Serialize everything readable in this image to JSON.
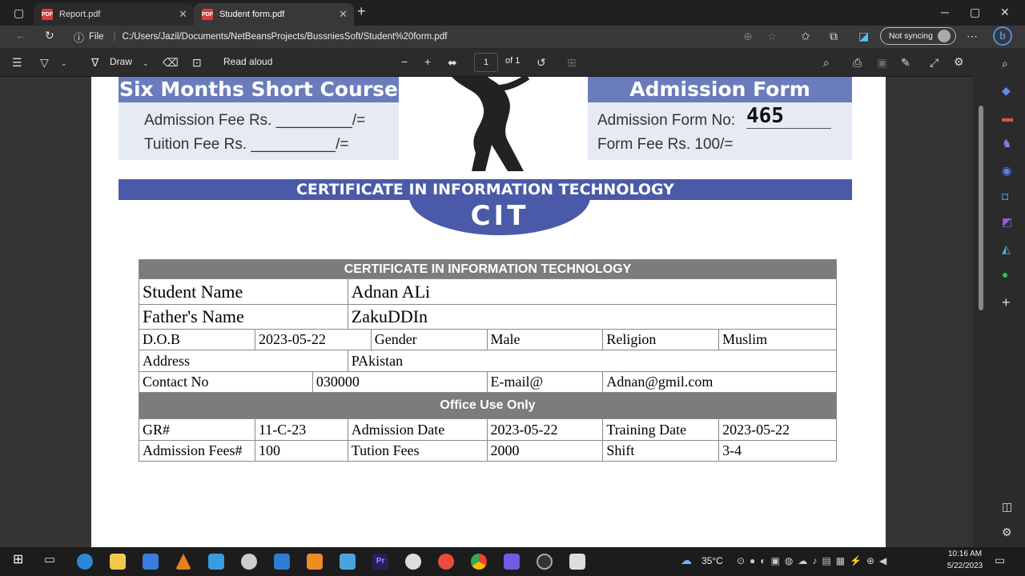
{
  "tabs": [
    {
      "label": "Report.pdf"
    },
    {
      "label": "Student form.pdf"
    }
  ],
  "address": {
    "prefix": "File",
    "url": "C:/Users/Jazil/Documents/NetBeansProjects/BussniesSoft/Student%20form.pdf",
    "sync_label": "Not syncing"
  },
  "pdf_toolbar": {
    "draw_label": "Draw",
    "read_aloud_label": "Read aloud",
    "page_number": "1",
    "page_total": "of 1"
  },
  "document": {
    "header_left_title": "Six Months Short Course",
    "admission_fee_label": "Admission Fee Rs. _________/=",
    "tuition_fee_label": "Tuition Fee Rs. __________/=",
    "header_right_title": "Admission Form",
    "admission_form_no_label": "Admission Form No:",
    "admission_form_no_value": "465",
    "form_fee_label": "Form Fee Rs. 100/=",
    "banner_text": "CERTIFICATE IN INFORMATION TECHNOLOGY",
    "logo_text": "CIT",
    "table_title": "CERTIFICATE IN INFORMATION TECHNOLOGY",
    "student_name_label": "Student Name",
    "student_name_value": "Adnan ALi",
    "father_name_label": "Father's Name",
    "father_name_value": "ZakuDDIn",
    "dob_label": "D.O.B",
    "dob_value": "2023-05-22",
    "gender_label": "Gender",
    "gender_value": "Male",
    "religion_label": "Religion",
    "religion_value": "Muslim",
    "address_label": "Address",
    "address_value": "PAkistan",
    "contact_label": "Contact No",
    "contact_value": "030000",
    "email_label": "E-mail@",
    "email_value": "Adnan@gmil.com",
    "office_header": "Office Use Only",
    "gr_label": "GR#",
    "gr_value": "11-C-23",
    "admission_date_label": "Admission Date",
    "admission_date_value": "2023-05-22",
    "training_date_label": "Training Date",
    "training_date_value": "2023-05-22",
    "admission_fees_label": "Admission Fees#",
    "admission_fees_value": "100",
    "tuition_fees_label": "Tution Fees",
    "tuition_fees_value": "2000",
    "shift_label": "Shift",
    "shift_value": "3-4"
  },
  "taskbar": {
    "temperature": "35°C",
    "time": "10:16 AM",
    "date": "5/22/2023"
  },
  "colors": {
    "accent_blue": "#6a7cbc",
    "banner_blue": "#4a5aa8",
    "table_header_gray": "#7c7c7c"
  }
}
